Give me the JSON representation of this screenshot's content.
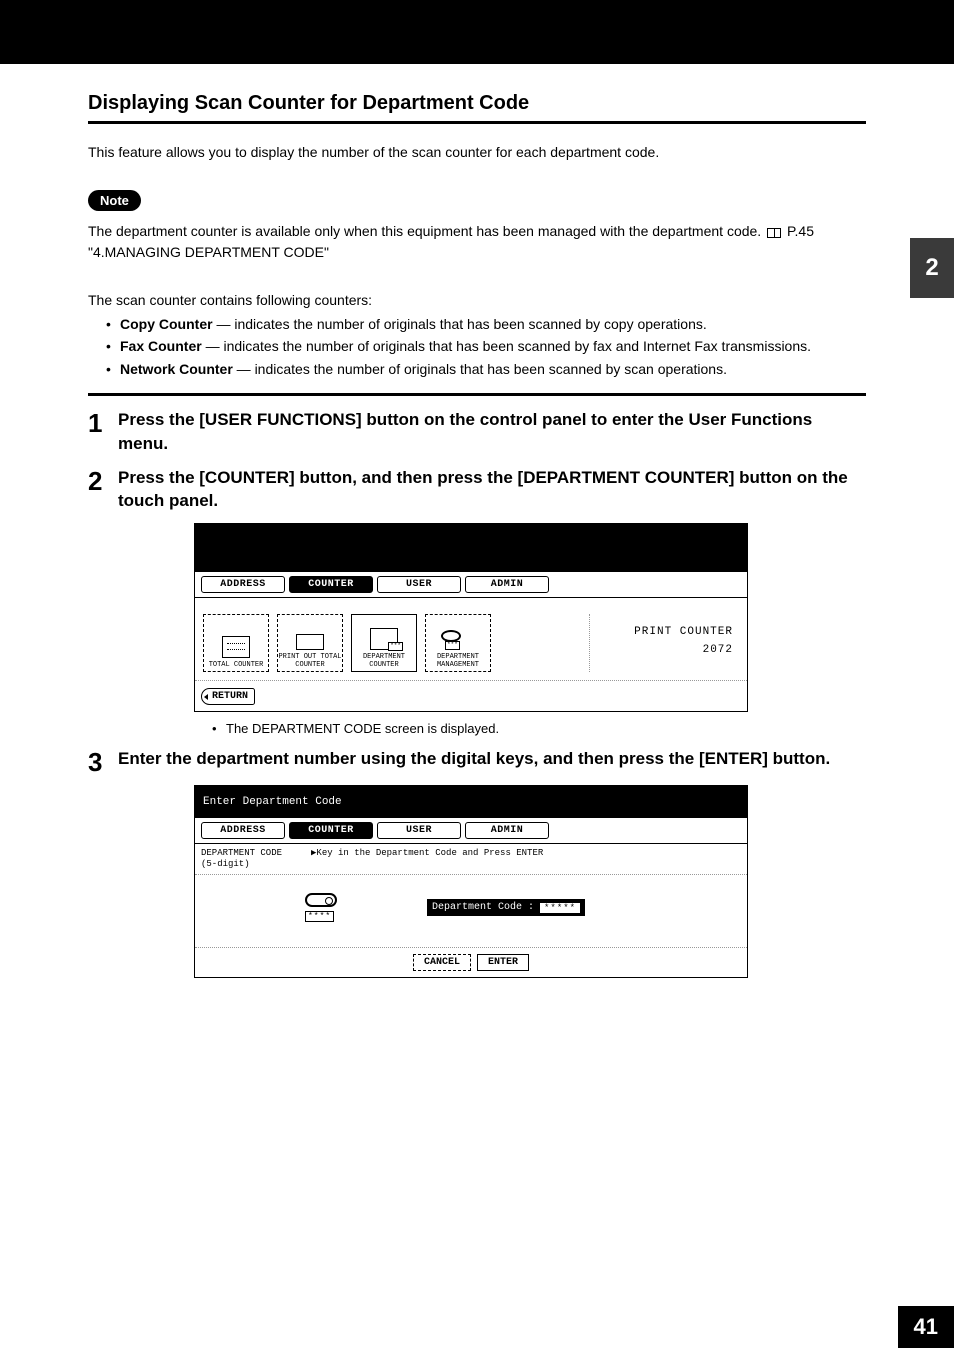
{
  "section_title": "Displaying Scan Counter for Department Code",
  "intro": "This feature allows you to display the number of the scan counter for each department code.",
  "note_label": "Note",
  "note_text_pre": "The department counter is available only when this equipment has been managed with the department code. ",
  "note_text_ref": " P.45 \"4.MANAGING DEPARTMENT CODE\"",
  "counters_intro": "The scan counter contains following counters:",
  "bullets": [
    {
      "term": "Copy Counter",
      "desc": " — indicates the number of originals that has been scanned by copy operations."
    },
    {
      "term": "Fax Counter",
      "desc": " — indicates the number of originals that has been scanned by fax and Internet Fax transmissions."
    },
    {
      "term": "Network Counter",
      "desc": " — indicates the number of originals that has been scanned by scan operations."
    }
  ],
  "steps": {
    "s1_num": "1",
    "s1_text": "Press the [USER FUNCTIONS] button on the control panel to enter the User Functions menu.",
    "s2_num": "2",
    "s2_text": "Press the [COUNTER] button, and then press the [DEPARTMENT COUNTER] button on the touch panel.",
    "s2_bullet": "The DEPARTMENT CODE screen is displayed.",
    "s3_num": "3",
    "s3_text": "Enter the department number using the digital keys, and then press the [ENTER] button."
  },
  "shot1": {
    "tabs": {
      "address": "ADDRESS",
      "counter": "COUNTER",
      "user": "USER",
      "admin": "ADMIN"
    },
    "icons": {
      "total": "TOTAL COUNTER",
      "print": "PRINT OUT TOTAL COUNTER",
      "dept": "DEPARTMENT COUNTER",
      "mgmt": "DEPARTMENT MANAGEMENT"
    },
    "right_label": "PRINT COUNTER",
    "right_value": "2072",
    "return": "RETURN"
  },
  "shot2": {
    "head": "Enter Department Code",
    "tabs": {
      "address": "ADDRESS",
      "counter": "COUNTER",
      "user": "USER",
      "admin": "ADMIN"
    },
    "sub_left_a": "DEPARTMENT CODE",
    "sub_left_b": "(5-digit)",
    "sub_right": "▶Key in the Department Code and Press ENTER",
    "key_label": "****",
    "dc_label": "Department Code :",
    "dc_value": "*****",
    "cancel": "CANCEL",
    "enter": "ENTER"
  },
  "side_tab": "2",
  "page_num": "41"
}
